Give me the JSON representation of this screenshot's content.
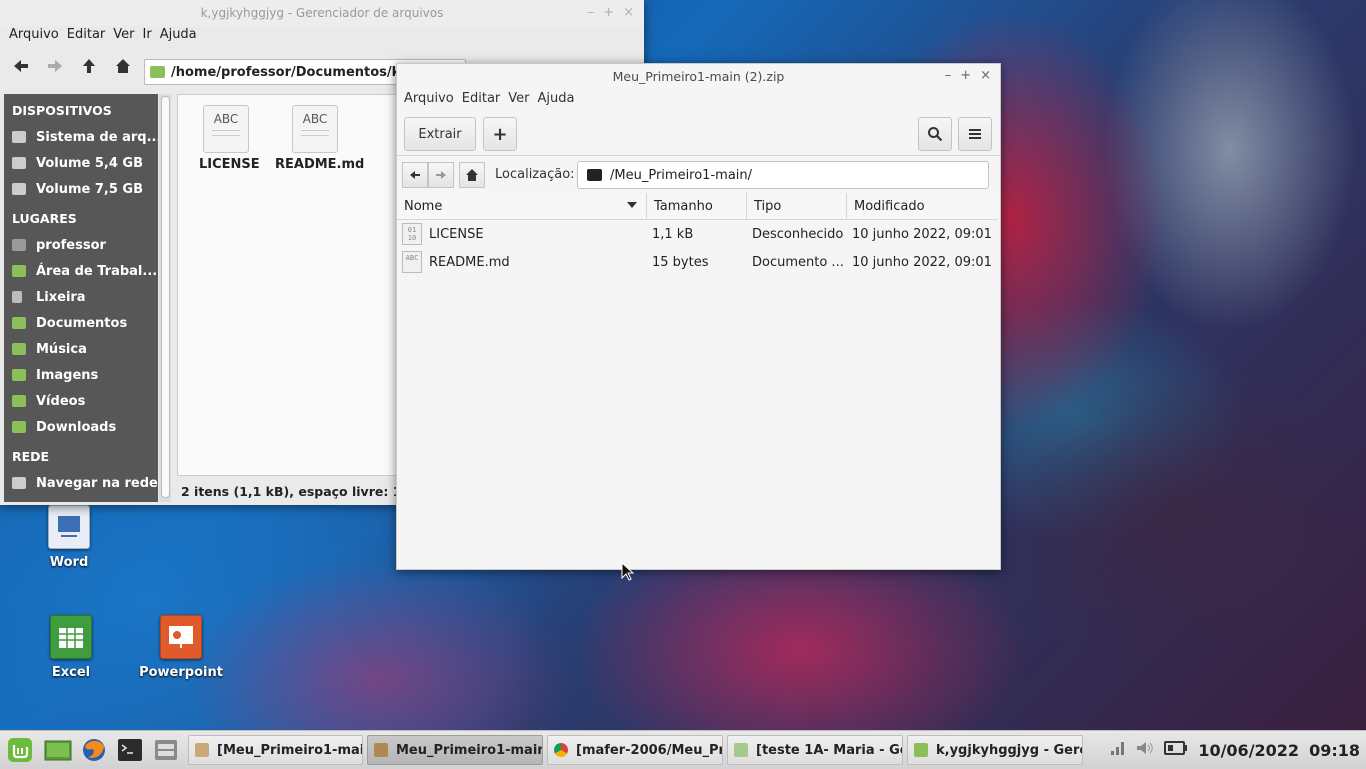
{
  "desktop": {
    "icons": [
      {
        "label": "Word",
        "icon": "word-icon"
      },
      {
        "label": "Excel",
        "icon": "excel-icon"
      },
      {
        "label": "Powerpoint",
        "icon": "powerpoint-icon"
      }
    ]
  },
  "file_manager": {
    "title": "k,ygjkyhggjyg - Gerenciador de arquivos",
    "menu": [
      "Arquivo",
      "Editar",
      "Ver",
      "Ir",
      "Ajuda"
    ],
    "path": "/home/professor/Documentos/k,yg",
    "sidebar": {
      "devices_header": "DISPOSITIVOS",
      "devices": [
        "Sistema de arq...",
        "Volume 5,4 GB",
        "Volume 7,5 GB"
      ],
      "places_header": "LUGARES",
      "places": [
        "professor",
        "Área de Trabal...",
        "Lixeira",
        "Documentos",
        "Música",
        "Imagens",
        "Vídeos",
        "Downloads"
      ],
      "network_header": "REDE",
      "network": [
        "Navegar na rede"
      ]
    },
    "files": [
      {
        "name": "LICENSE",
        "icon_text": "ABC"
      },
      {
        "name": "README.md",
        "icon_text": "ABC"
      }
    ],
    "status": "2 itens (1,1 kB), espaço livre: 12,5 G"
  },
  "archive_manager": {
    "title": "Meu_Primeiro1-main (2).zip",
    "menu": [
      "Arquivo",
      "Editar",
      "Ver",
      "Ajuda"
    ],
    "extract_label": "Extrair",
    "add_label": "+",
    "location_label": "Localização:",
    "location_value": "/Meu_Primeiro1-main/",
    "columns": [
      "Nome",
      "Tamanho",
      "Tipo",
      "Modificado"
    ],
    "rows": [
      {
        "name": "LICENSE",
        "size": "1,1 kB",
        "type": "Desconhecido",
        "modified": "10 junho 2022, 09:01",
        "icon_text": "01\n10"
      },
      {
        "name": "README.md",
        "size": "15 bytes",
        "type": "Documento ...",
        "modified": "10 junho 2022, 09:01",
        "icon_text": "ABC"
      }
    ]
  },
  "taskbar": {
    "tasks": [
      {
        "label": "[Meu_Primeiro1-mai...",
        "active": false
      },
      {
        "label": "Meu_Primeiro1-main ...",
        "active": true
      },
      {
        "label": "[mafer-2006/Meu_Pri...",
        "active": false
      },
      {
        "label": "[teste 1A- Maria - Ger...",
        "active": false
      },
      {
        "label": "k,ygjkyhggjyg - Gere...",
        "active": false
      }
    ],
    "date": "10/06/2022",
    "time": "09:18"
  },
  "colors": {
    "sidebar_bg": "#575757",
    "mint_green": "#6cbb3c",
    "folder_green": "#8bbf5a"
  }
}
